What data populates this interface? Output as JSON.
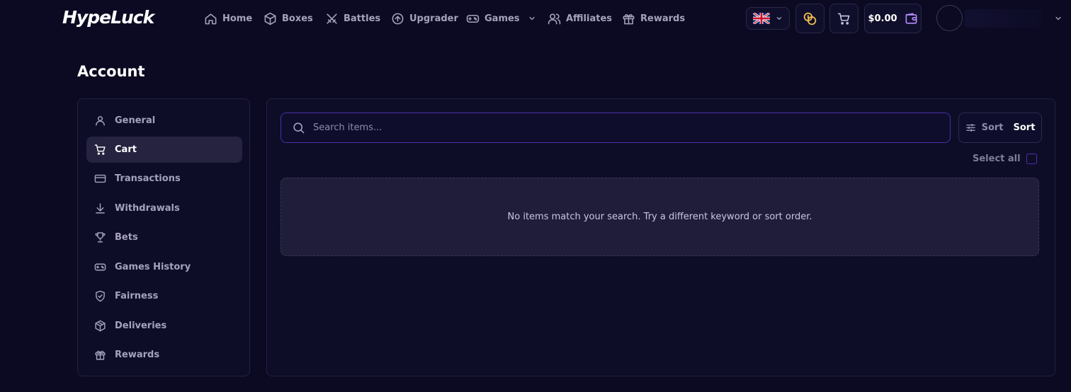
{
  "brand": {
    "logo_text": "HypeLuck"
  },
  "nav": {
    "items": [
      {
        "label": "Home",
        "icon": "home-icon"
      },
      {
        "label": "Boxes",
        "icon": "box-icon"
      },
      {
        "label": "Battles",
        "icon": "swords-icon"
      },
      {
        "label": "Upgrader",
        "icon": "upgrade-icon"
      },
      {
        "label": "Games",
        "icon": "gamepad-icon"
      },
      {
        "label": "Affiliates",
        "icon": "users-icon"
      },
      {
        "label": "Rewards",
        "icon": "gift-icon"
      }
    ]
  },
  "header": {
    "language_icon": "uk-flag-icon",
    "balance": "$0.00"
  },
  "page": {
    "title": "Account"
  },
  "sidebar": {
    "items": [
      {
        "label": "General",
        "icon": "user-icon"
      },
      {
        "label": "Cart",
        "icon": "cart-icon",
        "active": true
      },
      {
        "label": "Transactions",
        "icon": "credit-card-icon"
      },
      {
        "label": "Withdrawals",
        "icon": "download-icon"
      },
      {
        "label": "Bets",
        "icon": "trophy-icon"
      },
      {
        "label": "Games History",
        "icon": "gamepad-icon"
      },
      {
        "label": "Fairness",
        "icon": "shield-check-icon"
      },
      {
        "label": "Deliveries",
        "icon": "package-icon"
      },
      {
        "label": "Rewards",
        "icon": "gift-icon"
      }
    ]
  },
  "cart": {
    "search_placeholder": "Search items...",
    "sort_label": "Sort",
    "sort_value": "Sort",
    "select_all_label": "Select all",
    "empty_message": "No items match your search. Try a different keyword or sort order."
  },
  "colors": {
    "background": "#0b0a22",
    "panel": "#0e0d28",
    "accent": "#4a2fa8",
    "active_item": "#25233f",
    "coin": "#f2c14e"
  }
}
